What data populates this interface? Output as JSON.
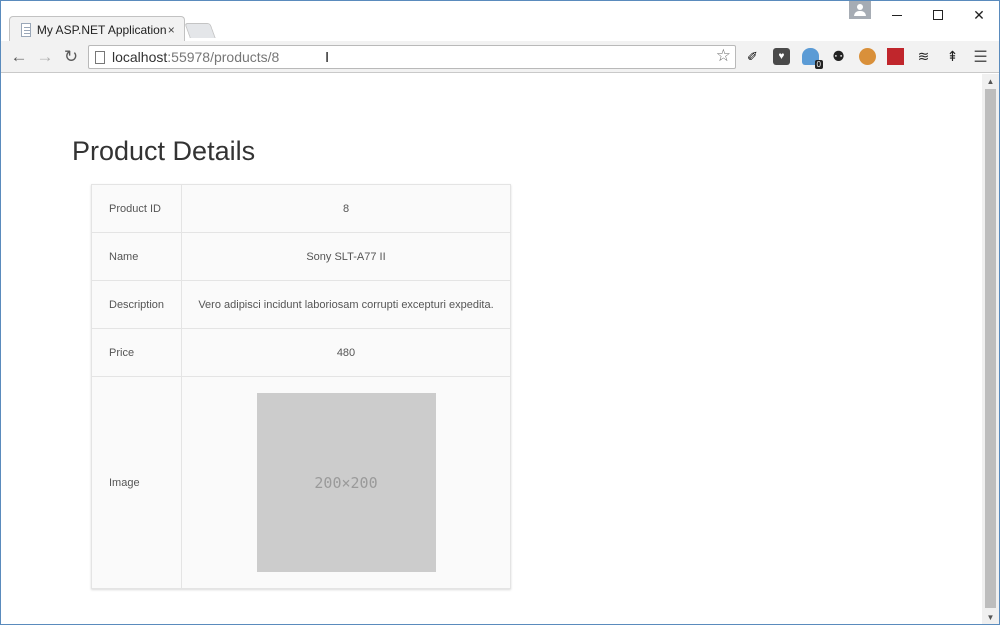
{
  "browser": {
    "tab_title": "My ASP.NET Application",
    "tab_close": "×",
    "url_host": "localhost",
    "url_rest": ":55978/products/8",
    "extensions": {
      "ghost_badge": "0"
    }
  },
  "page": {
    "title": "Product Details",
    "rows": [
      {
        "label": "Product ID",
        "value": "8"
      },
      {
        "label": "Name",
        "value": "Sony SLT-A77 II"
      },
      {
        "label": "Description",
        "value": "Vero adipisci incidunt laboriosam corrupti excepturi expedita."
      },
      {
        "label": "Price",
        "value": "480"
      }
    ],
    "image_row": {
      "label": "Image",
      "placeholder_text": "200×200"
    }
  },
  "colors": {
    "window_border": "#5a8bbd",
    "placeholder_bg": "#cccccc"
  }
}
